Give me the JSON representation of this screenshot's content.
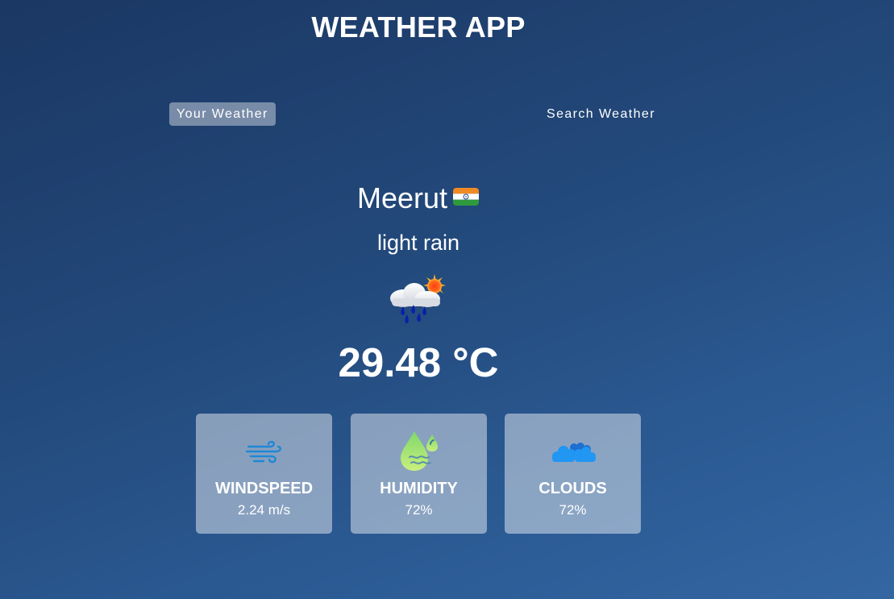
{
  "app": {
    "title": "WEATHER APP"
  },
  "tabs": [
    {
      "label": "Your Weather",
      "active": true
    },
    {
      "label": "Search Weather",
      "active": false
    }
  ],
  "weather": {
    "city": "Meerut",
    "country_flag_icon": "india-flag-icon",
    "description": "light rain",
    "condition_icon": "rain-cloud-sun-icon",
    "temperature": "29.48 °C"
  },
  "stats": [
    {
      "title": "WINDSPEED",
      "value": "2.24 m/s",
      "icon": "wind-icon"
    },
    {
      "title": "HUMIDITY",
      "value": "72%",
      "icon": "humidity-drop-icon"
    },
    {
      "title": "CLOUDS",
      "value": "72%",
      "icon": "clouds-icon"
    }
  ],
  "colors": {
    "background_top": "#1b3763",
    "background_bottom": "#3466a2",
    "card_background": "rgba(255,255,255,0.45)",
    "wind_icon": "#1e88d6",
    "humidity_icon": "#a8e06a",
    "clouds_icon": "#1e8be6"
  }
}
